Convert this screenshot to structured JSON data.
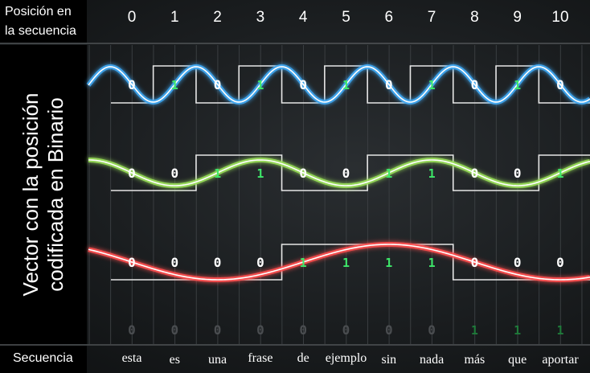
{
  "header": {
    "position_label_line1": "Posición en",
    "position_label_line2": "la secuencia",
    "vector_label_line1": "Vector con la posición",
    "vector_label_line2": "codificada en Binario",
    "sequence_label": "Secuencia"
  },
  "positions": [
    "0",
    "1",
    "2",
    "3",
    "4",
    "5",
    "6",
    "7",
    "8",
    "9",
    "10"
  ],
  "words": [
    "esta",
    "es",
    "una",
    "frase",
    "de",
    "ejemplo",
    "sin",
    "nada",
    "más",
    "que",
    "aportar"
  ],
  "bit_rows": [
    {
      "bits": [
        0,
        1,
        0,
        1,
        0,
        1,
        0,
        1,
        0,
        1,
        0
      ],
      "color": "#3fa9f5"
    },
    {
      "bits": [
        0,
        0,
        1,
        1,
        0,
        0,
        1,
        1,
        0,
        0,
        1
      ],
      "color": "#9be05a"
    },
    {
      "bits": [
        0,
        0,
        0,
        0,
        1,
        1,
        1,
        1,
        0,
        0,
        0
      ],
      "color": "#ff4d4d"
    },
    {
      "bits": [
        0,
        0,
        0,
        0,
        0,
        0,
        0,
        0,
        1,
        1,
        1
      ],
      "color": "#555555"
    }
  ],
  "colors": {
    "one_digit": "#3ee86a",
    "zero_digit": "#ffffff",
    "square_wave": "#e6e6e6"
  }
}
